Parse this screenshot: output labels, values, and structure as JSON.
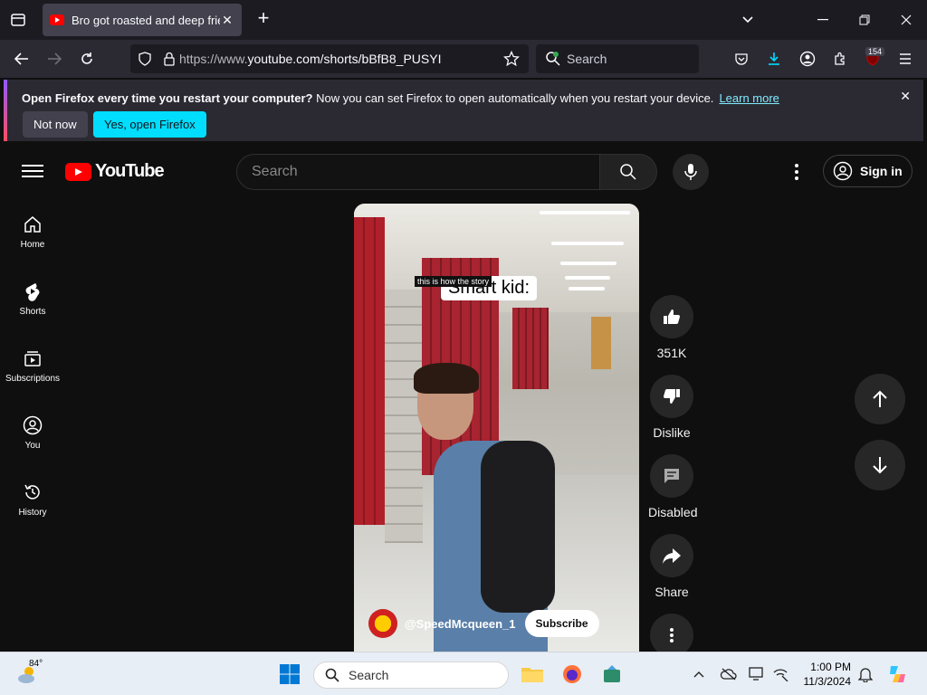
{
  "browser": {
    "tab_title": "Bro got roasted and deep fried",
    "url_prefix": "https://www.",
    "url_main": "youtube.com/shorts/bBfB8_PUSYI",
    "search_placeholder": "Search",
    "extension_badge": "154"
  },
  "notification": {
    "bold": "Open Firefox every time you restart your computer?",
    "text": " Now you can set Firefox to open automatically when you restart your device.",
    "link": "Learn more",
    "btn_not_now": "Not now",
    "btn_yes": "Yes, open Firefox"
  },
  "youtube": {
    "logo_text": "YouTube",
    "search_placeholder": "Search",
    "sign_in": "Sign in",
    "sidebar": [
      {
        "label": "Home"
      },
      {
        "label": "Shorts"
      },
      {
        "label": "Subscriptions"
      },
      {
        "label": "You"
      },
      {
        "label": "History"
      }
    ],
    "video": {
      "caption_small": "this is how the story",
      "caption_big": "Smart kid:",
      "channel": "@SpeedMcqueen_1",
      "subscribe": "Subscribe"
    },
    "actions": {
      "likes": "351K",
      "dislike": "Dislike",
      "comments": "Disabled",
      "share": "Share"
    }
  },
  "taskbar": {
    "temperature": "84°",
    "search": "Search",
    "time": "1:00 PM",
    "date": "11/3/2024"
  }
}
